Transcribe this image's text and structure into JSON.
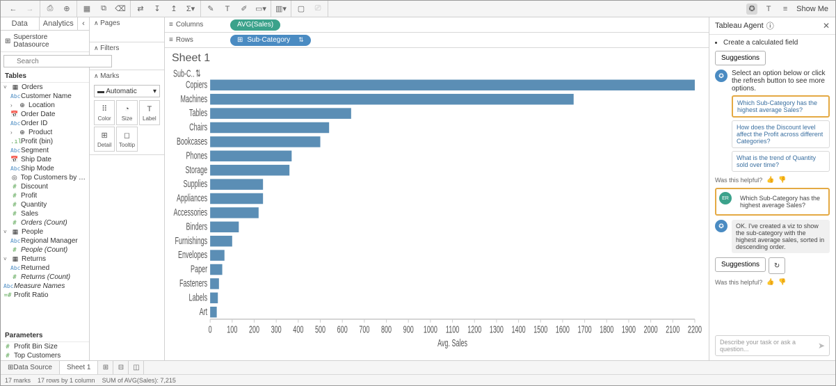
{
  "toolbar": {
    "show_me": "Show Me"
  },
  "left_panel": {
    "tab_data": "Data",
    "tab_analytics": "Analytics",
    "datasource": "Superstore Datasource",
    "search_placeholder": "Search",
    "tables_head": "Tables",
    "params_head": "Parameters",
    "tree": {
      "orders": "Orders",
      "customer_name": "Customer Name",
      "location": "Location",
      "order_date": "Order Date",
      "order_id": "Order ID",
      "product": "Product",
      "profit_bin": "Profit (bin)",
      "segment": "Segment",
      "ship_date": "Ship Date",
      "ship_mode": "Ship Mode",
      "top_customers": "Top Customers by P...",
      "discount": "Discount",
      "profit": "Profit",
      "quantity": "Quantity",
      "sales": "Sales",
      "orders_count": "Orders (Count)",
      "people": "People",
      "regional_manager": "Regional Manager",
      "people_count": "People (Count)",
      "returns": "Returns",
      "returned": "Returned",
      "returns_count": "Returns (Count)",
      "measure_names": "Measure Names",
      "profit_ratio": "Profit Ratio",
      "profit_bin_size": "Profit Bin Size",
      "top_customers_p": "Top Customers"
    }
  },
  "shelves": {
    "pages": "Pages",
    "filters": "Filters",
    "marks": "Marks",
    "automatic": "Automatic",
    "color": "Color",
    "size": "Size",
    "label": "Label",
    "detail": "Detail",
    "tooltip": "Tooltip",
    "columns": "Columns",
    "rows": "Rows",
    "col_pill": "AVG(Sales)",
    "row_pill": "Sub-Category"
  },
  "worksheet": {
    "title": "Sheet 1",
    "sub_label": "Sub-C..",
    "x_axis": "Avg. Sales"
  },
  "chart_data": {
    "type": "bar",
    "orientation": "horizontal",
    "xlabel": "Avg. Sales",
    "ylabel": "Sub-Category",
    "xlim": [
      0,
      2200
    ],
    "xticks": [
      0,
      100,
      200,
      300,
      400,
      500,
      600,
      700,
      800,
      900,
      1000,
      1100,
      1200,
      1300,
      1400,
      1500,
      1600,
      1700,
      1800,
      1900,
      2000,
      2100,
      2200
    ],
    "categories": [
      "Copiers",
      "Machines",
      "Tables",
      "Chairs",
      "Bookcases",
      "Phones",
      "Storage",
      "Supplies",
      "Appliances",
      "Accessories",
      "Binders",
      "Furnishings",
      "Envelopes",
      "Paper",
      "Fasteners",
      "Labels",
      "Art"
    ],
    "values": [
      2200,
      1650,
      640,
      540,
      500,
      370,
      360,
      240,
      240,
      220,
      130,
      100,
      65,
      55,
      40,
      35,
      30
    ]
  },
  "agent": {
    "title": "Tableau Agent",
    "bullet1": "Create a calculated field",
    "suggestions_btn": "Suggestions",
    "prompt1": "Select an option below or click the refresh button to see more options.",
    "sugg1": "Which Sub-Category has the highest average Sales?",
    "sugg2": "How does the Discount level affect the Profit across different Categories?",
    "sugg3": "What is the trend of Quantity sold over time?",
    "helpful": "Was this helpful?",
    "user_avatar": "ER",
    "user_msg": "Which Sub-Category has the highest average Sales?",
    "reply": "OK. I've created a viz to show the sub-category with the highest average sales, sorted in descending order.",
    "input_placeholder": "Describe your task or ask a question..."
  },
  "bottom": {
    "data_source": "Data Source",
    "sheet1": "Sheet 1"
  },
  "status": {
    "marks": "17 marks",
    "rows": "17 rows by 1 column",
    "sum": "SUM of AVG(Sales): 7,215"
  }
}
